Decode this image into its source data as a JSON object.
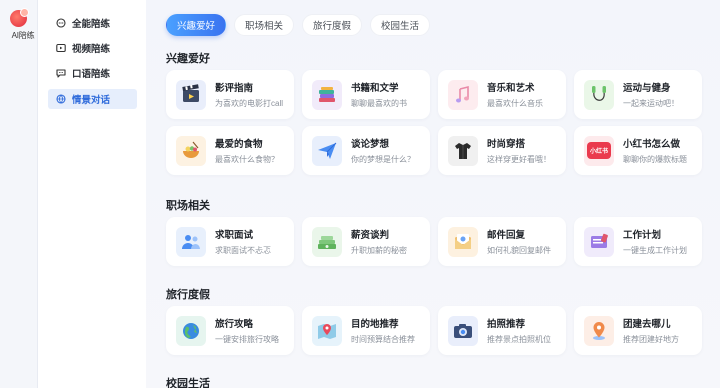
{
  "brand": {
    "logo_text": "AI陪练"
  },
  "menu": {
    "items": [
      {
        "label": "全能陪练",
        "icon": "chat-bubble-icon",
        "active": false
      },
      {
        "label": "视频陪练",
        "icon": "video-icon",
        "active": false
      },
      {
        "label": "口语陪练",
        "icon": "speech-bubble-icon",
        "active": false
      },
      {
        "label": "情景对话",
        "icon": "globe-icon",
        "active": true
      }
    ]
  },
  "tabs": [
    {
      "label": "兴趣爱好",
      "active": true
    },
    {
      "label": "职场相关",
      "active": false
    },
    {
      "label": "旅行度假",
      "active": false
    },
    {
      "label": "校园生活",
      "active": false
    }
  ],
  "sections": [
    {
      "title": "兴趣爱好",
      "cards": [
        {
          "title": "影评指南",
          "subtitle": "为喜欢的电影打call",
          "icon": "film-icon",
          "color": "#e9eefb"
        },
        {
          "title": "书籍和文学",
          "subtitle": "聊聊最喜欢的书",
          "icon": "books-icon",
          "color": "#f1ebfa"
        },
        {
          "title": "音乐和艺术",
          "subtitle": "最喜欢什么音乐",
          "icon": "music-notes-icon",
          "color": "#fdecef"
        },
        {
          "title": "运动与健身",
          "subtitle": "一起来运动吧！",
          "icon": "jump-rope-icon",
          "color": "#eaf7e8"
        },
        {
          "title": "最爱的食物",
          "subtitle": "最喜欢什么食物？",
          "icon": "food-bowl-icon",
          "color": "#fdf2e2"
        },
        {
          "title": "谈论梦想",
          "subtitle": "你的梦想是什么？",
          "icon": "paper-plane-icon",
          "color": "#e8effc"
        },
        {
          "title": "时尚穿搭",
          "subtitle": "这样穿更好看哦！",
          "icon": "outfit-icon",
          "color": "#f0f0f0"
        },
        {
          "title": "小红书怎么做",
          "subtitle": "聊聊你的爆款标题",
          "icon": "xiaohongshu-icon",
          "color": "#fdeaec",
          "icon_text": "小红书"
        }
      ]
    },
    {
      "title": "职场相关",
      "cards": [
        {
          "title": "求职面试",
          "subtitle": "求职面试不忐忑",
          "icon": "interview-icon",
          "color": "#e8f0fc"
        },
        {
          "title": "薪资谈判",
          "subtitle": "升职加薪的秘密",
          "icon": "money-stack-icon",
          "color": "#eaf6ea"
        },
        {
          "title": "邮件回复",
          "subtitle": "如何礼貌回复邮件",
          "icon": "mail-icon",
          "color": "#fdf1e0"
        },
        {
          "title": "工作计划",
          "subtitle": "一键生成工作计划",
          "icon": "work-plan-icon",
          "color": "#f0ebfb"
        }
      ]
    },
    {
      "title": "旅行度假",
      "cards": [
        {
          "title": "旅行攻略",
          "subtitle": "一键安排旅行攻略",
          "icon": "earth-icon",
          "color": "#e6f5ef"
        },
        {
          "title": "目的地推荐",
          "subtitle": "时间预算结合推荐",
          "icon": "map-pin-icon",
          "color": "#e6f3fb"
        },
        {
          "title": "拍照推荐",
          "subtitle": "推荐景点拍照机位",
          "icon": "camera-icon",
          "color": "#e9eefb"
        },
        {
          "title": "团建去哪儿",
          "subtitle": "推荐团建好地方",
          "icon": "location-icon",
          "color": "#fdeee6"
        }
      ]
    },
    {
      "title": "校园生活",
      "cards": []
    }
  ]
}
